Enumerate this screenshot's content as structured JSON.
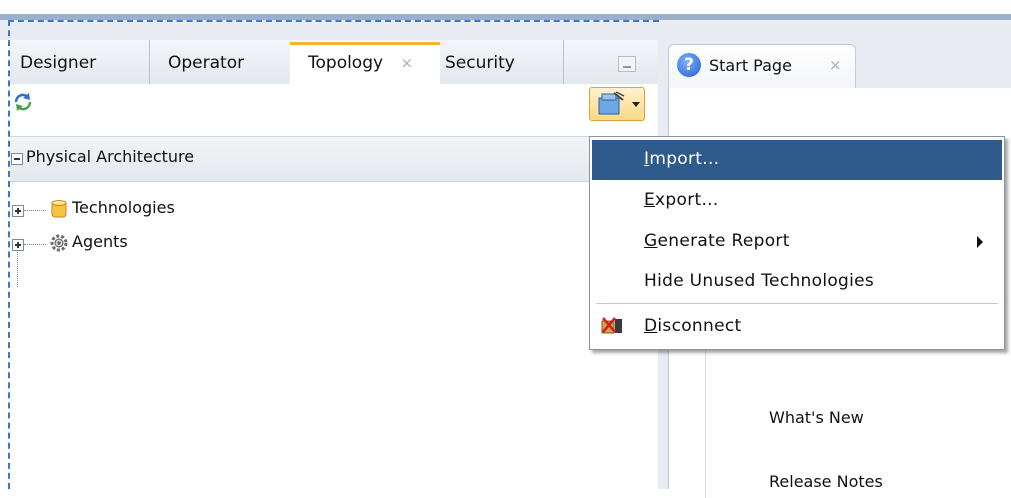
{
  "left_tabs": [
    {
      "label": "Designer"
    },
    {
      "label": "Operator"
    },
    {
      "label": "Topology",
      "active": true
    },
    {
      "label": "Security"
    }
  ],
  "tab_close_glyph": "×",
  "section": {
    "label": "Physical Architecture"
  },
  "tree": [
    {
      "label": "Technologies",
      "icon": "database-icon"
    },
    {
      "label": "Agents",
      "icon": "gear-icon"
    }
  ],
  "right_tab": {
    "label": "Start Page",
    "help_glyph": "?"
  },
  "right_links": [
    "What's New",
    "Release Notes"
  ],
  "menu": {
    "import": {
      "mnemonic": "I",
      "rest": "mport..."
    },
    "export": {
      "mnemonic": "E",
      "rest": "xport..."
    },
    "generate": {
      "mnemonic": "G",
      "rest": "enerate Report"
    },
    "hide": {
      "label": "Hide Unused Technologies"
    },
    "disconnect": {
      "mnemonic": "D",
      "rest": "isconnect"
    }
  },
  "colors": {
    "menu_selected": "#2f5a8c",
    "active_tab_accent": "#f3b335",
    "focus_border": "#3c78c8"
  }
}
